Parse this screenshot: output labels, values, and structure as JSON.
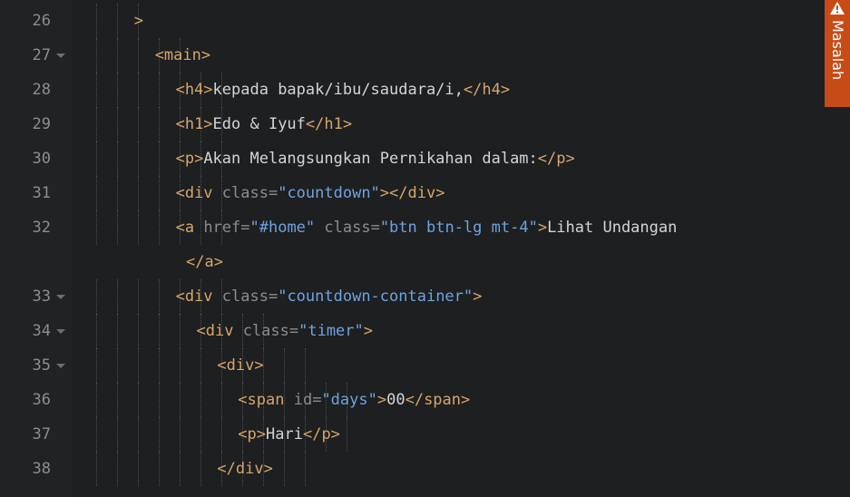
{
  "editor": {
    "line_numbers": [
      "26",
      "27",
      "28",
      "29",
      "30",
      "31",
      "32",
      "33",
      "34",
      "35",
      "36",
      "37",
      "38"
    ],
    "lines": [
      {
        "tokens": [
          {
            "t": ">",
            "c": "tag"
          }
        ]
      },
      {
        "tokens": [
          {
            "t": "<main>",
            "c": "tag"
          }
        ]
      },
      {
        "tokens": [
          {
            "t": "<h4>",
            "c": "tag"
          },
          {
            "t": "kepada bapak/ibu/saudara/i,",
            "c": "txt"
          },
          {
            "t": "</h4>",
            "c": "tag"
          }
        ]
      },
      {
        "tokens": [
          {
            "t": "<h1>",
            "c": "tag"
          },
          {
            "t": "Edo & Iyuf",
            "c": "txt"
          },
          {
            "t": "</h1>",
            "c": "tag"
          }
        ]
      },
      {
        "tokens": [
          {
            "t": "<p>",
            "c": "tag"
          },
          {
            "t": "Akan Melangsungkan Pernikahan dalam:",
            "c": "txt"
          },
          {
            "t": "</p>",
            "c": "tag"
          }
        ]
      },
      {
        "tokens": [
          {
            "t": "<div ",
            "c": "tag"
          },
          {
            "t": "class=",
            "c": "attr"
          },
          {
            "t": "\"countdown\"",
            "c": "str"
          },
          {
            "t": "></div>",
            "c": "tag"
          }
        ]
      },
      {
        "tokens": [
          {
            "t": "<a ",
            "c": "tag"
          },
          {
            "t": "href=",
            "c": "attr"
          },
          {
            "t": "\"#home\"",
            "c": "str"
          },
          {
            "t": " class=",
            "c": "attr"
          },
          {
            "t": "\"btn btn-lg mt-4\"",
            "c": "str"
          },
          {
            "t": ">",
            "c": "tag"
          },
          {
            "t": "Lihat Undangan",
            "c": "txt"
          }
        ]
      },
      {
        "tokens": [
          {
            "t": "</a>",
            "c": "tag"
          }
        ]
      },
      {
        "tokens": [
          {
            "t": "<div ",
            "c": "tag"
          },
          {
            "t": "class=",
            "c": "attr"
          },
          {
            "t": "\"countdown-container\"",
            "c": "str"
          },
          {
            "t": ">",
            "c": "tag"
          }
        ]
      },
      {
        "tokens": [
          {
            "t": "<div ",
            "c": "tag"
          },
          {
            "t": "class=",
            "c": "attr"
          },
          {
            "t": "\"timer\"",
            "c": "str"
          },
          {
            "t": ">",
            "c": "tag"
          }
        ]
      },
      {
        "tokens": [
          {
            "t": "<div>",
            "c": "tag"
          }
        ]
      },
      {
        "tokens": [
          {
            "t": "<span ",
            "c": "tag"
          },
          {
            "t": "id=",
            "c": "attr"
          },
          {
            "t": "\"days\"",
            "c": "str"
          },
          {
            "t": ">",
            "c": "tag"
          },
          {
            "t": "00",
            "c": "txt"
          },
          {
            "t": "</span>",
            "c": "tag"
          }
        ]
      },
      {
        "tokens": [
          {
            "t": "<p>",
            "c": "tag"
          },
          {
            "t": "Hari",
            "c": "txt"
          },
          {
            "t": "</p>",
            "c": "tag"
          }
        ]
      },
      {
        "tokens": [
          {
            "t": "</div>",
            "c": "tag"
          }
        ]
      }
    ]
  },
  "problems_panel": {
    "label": "Masalah",
    "icon": "warning-icon"
  },
  "colors": {
    "background": "#1d1f21",
    "gutter": "#202224",
    "tag": "#d7a56a",
    "attribute": "#8c8c8c",
    "string": "#6fa3de",
    "text": "#d4d4d4",
    "problems_panel": "#c74b16"
  }
}
